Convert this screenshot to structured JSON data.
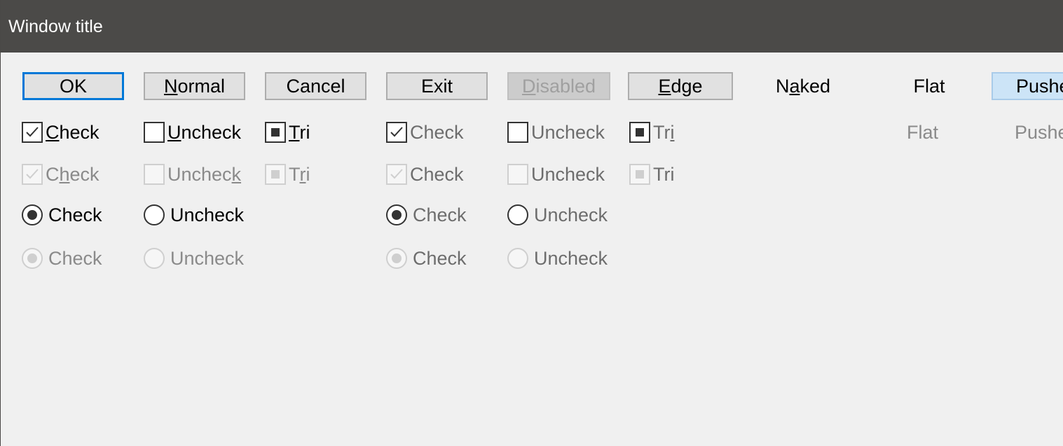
{
  "window": {
    "title": "Window title"
  },
  "buttons": {
    "ok": "OK",
    "normal_prefix": "",
    "normal_ul": "N",
    "normal_rest": "ormal",
    "cancel": "Cancel",
    "exit": "Exit",
    "disabled_ul": "D",
    "disabled_rest": "isabled",
    "edge_ul": "E",
    "edge_rest": "dge",
    "naked_pre": "N",
    "naked_ul": "a",
    "naked_rest": "ked",
    "flat": "Flat",
    "pushed": "Pushe"
  },
  "row1": {
    "check_ul": "C",
    "check_rest": "heck",
    "uncheck_ul": "U",
    "uncheck_rest": "ncheck",
    "tri_ul": "T",
    "tri_rest": "ri",
    "check2": "Check",
    "uncheck2": "Uncheck",
    "tri2_pre": "Tr",
    "tri2_ul": "i",
    "flat": "Flat",
    "pushed": "Pushe"
  },
  "row2": {
    "check_pre": "C",
    "check_ul": "h",
    "check_rest": "eck",
    "uncheck_pre": "Unchec",
    "uncheck_ul": "k",
    "tri_pre": "T",
    "tri_ul": "r",
    "tri_rest": "i",
    "check2": "Check",
    "uncheck2": "Uncheck",
    "tri2": "Tri"
  },
  "row3": {
    "check": "Check",
    "uncheck": "Uncheck",
    "check2": "Check",
    "uncheck2": "Uncheck"
  },
  "row4": {
    "check": "Check",
    "uncheck": "Uncheck",
    "check2": "Check",
    "uncheck2": "Uncheck"
  },
  "colors": {
    "titlebar": "#4b4a48",
    "background": "#f0f0f0",
    "accent": "#0078d7",
    "pushed_bg": "#cce4f7"
  }
}
